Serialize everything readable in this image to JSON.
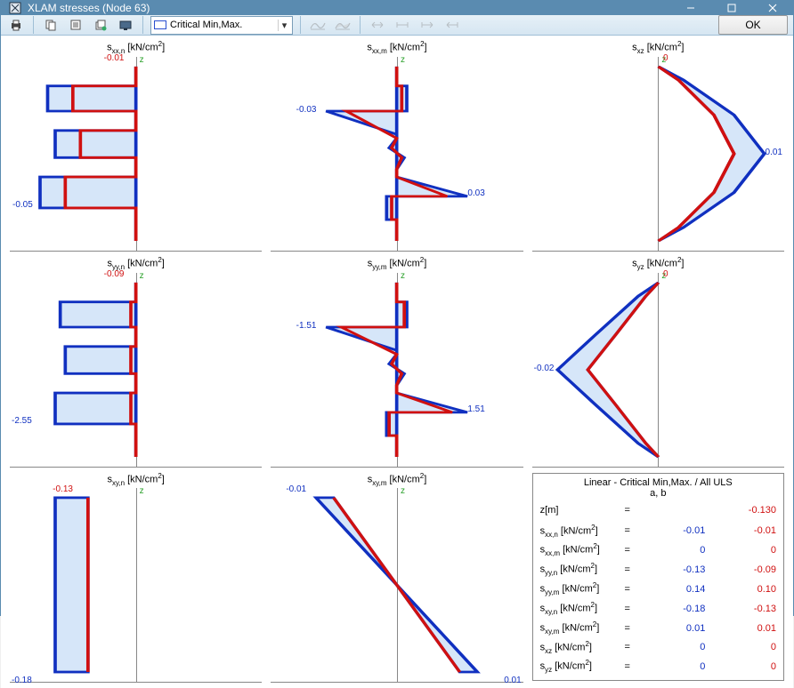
{
  "window": {
    "title": "XLAM stresses (Node 63)"
  },
  "toolbar": {
    "combo_label": "Critical Min,Max.",
    "ok_label": "OK"
  },
  "unit": "kN/cm",
  "axis_label": "z",
  "plots": {
    "sxxn": {
      "sym": "s",
      "sub": "xx,n",
      "min": "-0.05",
      "max": "-0.01"
    },
    "sxxm": {
      "sym": "s",
      "sub": "xx,m",
      "min": "-0.03",
      "max": "0.03"
    },
    "sxz": {
      "sym": "s",
      "sub": "xz",
      "min": "0",
      "max": "0.01"
    },
    "syyn": {
      "sym": "s",
      "sub": "yy,n",
      "min": "-2.55",
      "max": "-0.09"
    },
    "syym": {
      "sym": "s",
      "sub": "yy,m",
      "min": "-1.51",
      "max": "1.51"
    },
    "syz": {
      "sym": "s",
      "sub": "yz",
      "min": "-0.02",
      "max": "0"
    },
    "sxyn": {
      "sym": "s",
      "sub": "xy,n",
      "min": "-0.18",
      "max": "-0.13"
    },
    "sxym": {
      "sym": "s",
      "sub": "xy,m",
      "min": "-0.01",
      "max": "0.01"
    }
  },
  "info": {
    "title1": "Linear - Critical Min,Max. / All ULS",
    "title2": "a, b",
    "zrow": {
      "name": "z[m]",
      "va": "",
      "vb": "-0.130"
    },
    "rows": [
      {
        "sub": "xx,n",
        "va": "-0.01",
        "vb": "-0.01"
      },
      {
        "sub": "xx,m",
        "va": "0",
        "vb": "0"
      },
      {
        "sub": "yy,n",
        "va": "-0.13",
        "vb": "-0.09"
      },
      {
        "sub": "yy,m",
        "va": "0.14",
        "vb": "0.10"
      },
      {
        "sub": "xy,n",
        "va": "-0.18",
        "vb": "-0.13"
      },
      {
        "sub": "xy,m",
        "va": "0.01",
        "vb": "0.01"
      },
      {
        "sub": "xz",
        "va": "0",
        "vb": "0"
      },
      {
        "sub": "yz",
        "va": "0",
        "vb": "0"
      }
    ]
  },
  "chart_data": [
    {
      "id": "sxxn",
      "type": "profile",
      "title": "s_xx,n [kN/cm2]",
      "blue_label": "-0.05",
      "red_label": "-0.01"
    },
    {
      "id": "sxxm",
      "type": "profile",
      "title": "s_xx,m [kN/cm2]",
      "blue_label": "-0.03",
      "red_label": "0.03"
    },
    {
      "id": "sxz",
      "type": "profile",
      "title": "s_xz [kN/cm2]",
      "red_label": "0",
      "blue_label": "0.01"
    },
    {
      "id": "syyn",
      "type": "profile",
      "title": "s_yy,n [kN/cm2]",
      "blue_label": "-2.55",
      "red_label": "-0.09"
    },
    {
      "id": "syym",
      "type": "profile",
      "title": "s_yy,m [kN/cm2]",
      "blue_label": "-1.51",
      "red_label": "1.51"
    },
    {
      "id": "syz",
      "type": "profile",
      "title": "s_yz [kN/cm2]",
      "blue_label": "-0.02",
      "red_label": "0"
    },
    {
      "id": "sxyn",
      "type": "profile",
      "title": "s_xy,n [kN/cm2]",
      "blue_label": "-0.18",
      "red_label": "-0.13"
    },
    {
      "id": "sxym",
      "type": "profile",
      "title": "s_xy,m [kN/cm2]",
      "blue_label": "-0.01",
      "red_label": "0.01"
    }
  ]
}
